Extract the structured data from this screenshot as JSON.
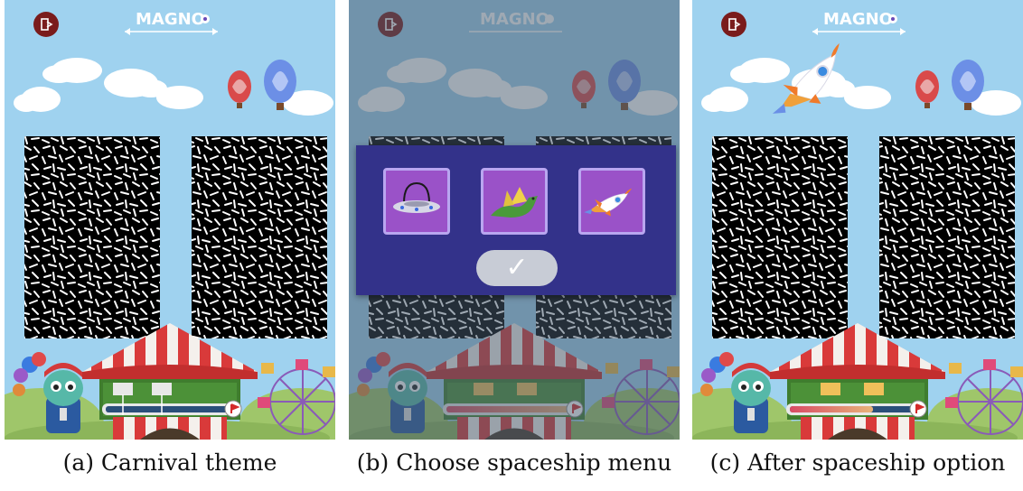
{
  "app": {
    "logo": "MAGNO"
  },
  "panels": [
    {
      "id": "a",
      "caption": "(a) Carnival theme"
    },
    {
      "id": "b",
      "caption": "(b) Choose spaceship menu"
    },
    {
      "id": "c",
      "caption": "(c) After spaceship option"
    }
  ],
  "menu": {
    "options": [
      "ufo",
      "dragon",
      "rocket"
    ],
    "confirm_label": "✓"
  },
  "colors": {
    "sky": "#9fd2ef",
    "exit_button": "#7a1c1c",
    "menu_bg": "#33328a",
    "option_bg": "#9a52c8"
  },
  "icons": [
    "exit-icon",
    "eye-icon",
    "ufo-icon",
    "dragon-icon",
    "rocket-icon",
    "checkmark-icon",
    "flag-icon",
    "gift-icon"
  ],
  "progress": {
    "a": 0.0,
    "b": 0.5,
    "c": 0.35
  }
}
